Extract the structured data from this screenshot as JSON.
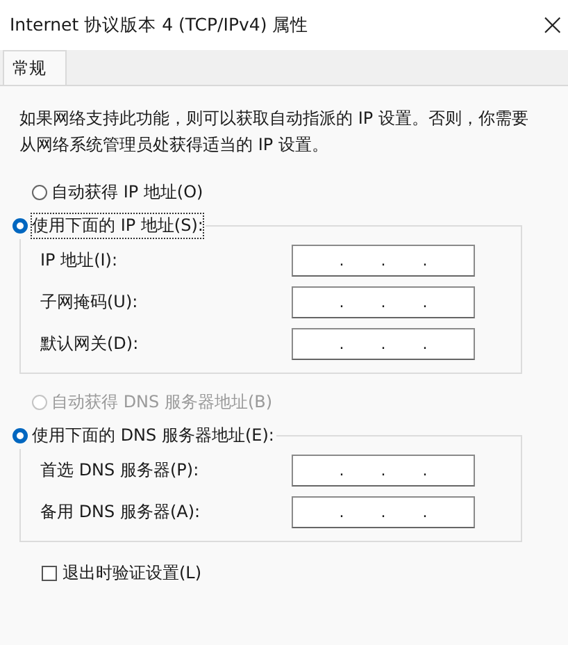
{
  "window": {
    "title": "Internet 协议版本 4 (TCP/IPv4) 属性",
    "close": "×"
  },
  "tabs": [
    {
      "label": "常规",
      "selected": true
    }
  ],
  "intro": "如果网络支持此功能，则可以获取自动指派的 IP 设置。否则，你需要从网络系统管理员处获得适当的 IP 设置。",
  "groups": [
    {
      "auto": {
        "label": "自动获得 IP 地址(O)",
        "selected": false,
        "disabled": false
      },
      "manual": {
        "label": "使用下面的 IP 地址(S):",
        "selected": true,
        "focused": true
      },
      "fields": [
        {
          "label": "IP 地址(I):",
          "separators": [
            ".",
            ".",
            "."
          ]
        },
        {
          "label": "子网掩码(U):",
          "separators": [
            ".",
            ".",
            "."
          ]
        },
        {
          "label": "默认网关(D):",
          "separators": [
            ".",
            ".",
            "."
          ]
        }
      ]
    },
    {
      "auto": {
        "label": "自动获得 DNS 服务器地址(B)",
        "selected": false,
        "disabled": true
      },
      "manual": {
        "label": "使用下面的 DNS 服务器地址(E):",
        "selected": true,
        "focused": false
      },
      "fields": [
        {
          "label": "首选 DNS 服务器(P):",
          "separators": [
            ".",
            ".",
            "."
          ]
        },
        {
          "label": "备用 DNS 服务器(A):",
          "separators": [
            ".",
            ".",
            "."
          ]
        }
      ]
    }
  ],
  "validate": {
    "label": "退出时验证设置(L)",
    "checked": false
  }
}
